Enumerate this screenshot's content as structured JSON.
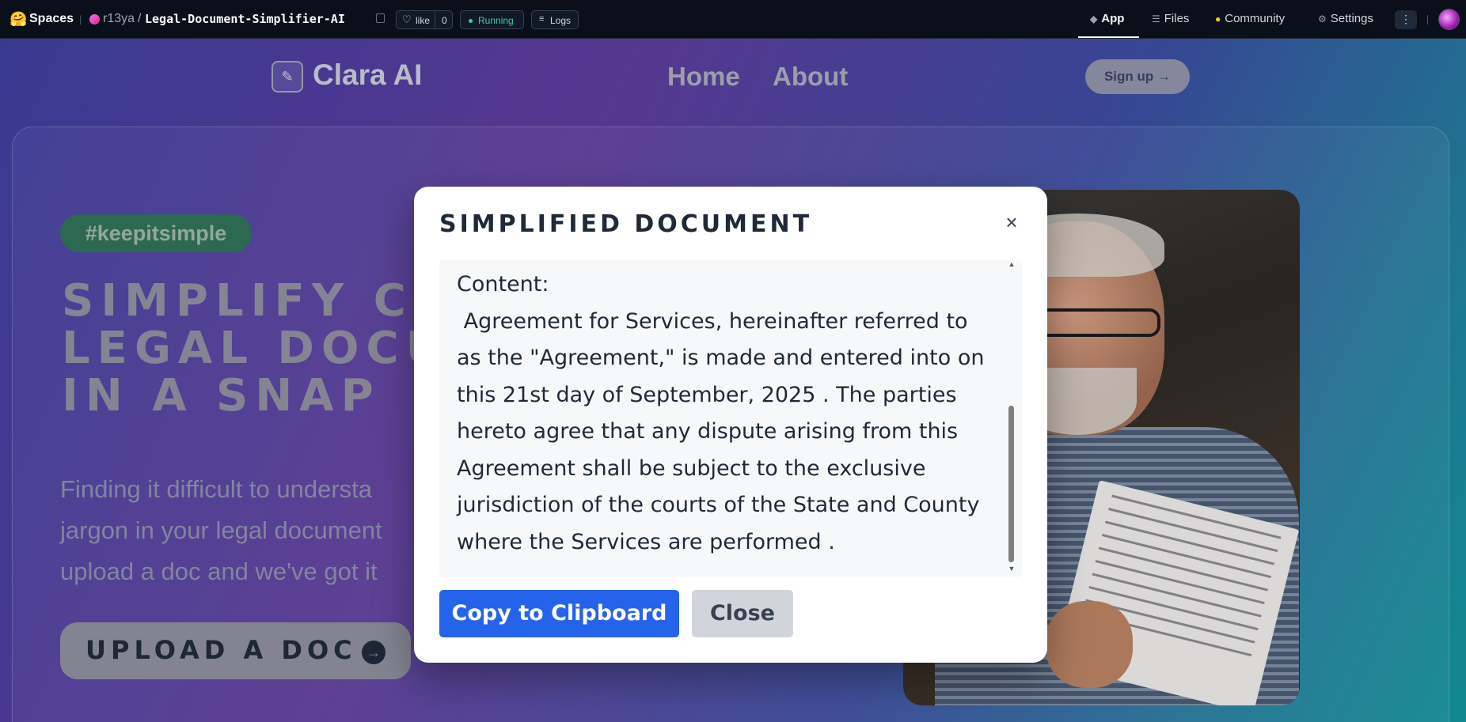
{
  "hf_bar": {
    "spaces_label": "Spaces",
    "owner": "r13ya",
    "separator": "/",
    "repo_name": "Legal-Document-Simplifier-AI",
    "like_label": "like",
    "like_count": "0",
    "status": "Running",
    "logs_label": "Logs",
    "nav": [
      {
        "label": "App",
        "icon": "cube-icon"
      },
      {
        "label": "Files",
        "icon": "files-icon"
      },
      {
        "label": "Community",
        "icon": "community-icon"
      },
      {
        "label": "Settings",
        "icon": "gear-icon"
      }
    ],
    "active_tab": "App",
    "status_color": "#34d399"
  },
  "app_header": {
    "brand": "Clara AI",
    "nav_home": "Home",
    "nav_about": "About",
    "signup_label": "Sign up →"
  },
  "hero": {
    "tag": "#keepitsimple",
    "headline": "SIMPLIFY C\nLEGAL DOCU\nIN A SNAP",
    "subtext": "Finding it difficult to understa\njargon in your legal document\nupload a doc and we've got it",
    "upload_label": "UPLOAD A DOC",
    "upload_arrow": "→"
  },
  "modal": {
    "title": "SIMPLIFIED DOCUMENT",
    "close_symbol": "×",
    "content": "Content:\n Agreement for Services, hereinafter referred to as the \"Agreement,\" is made and entered into on this 21st day of September, 2025 . The parties hereto agree that any dispute arising from this Agreement shall be subject to the exclusive jurisdiction of the courts of the State and County where the Services are performed .",
    "copy_label": "Copy to Clipboard",
    "close_label": "Close",
    "primary_color": "#2563eb"
  }
}
